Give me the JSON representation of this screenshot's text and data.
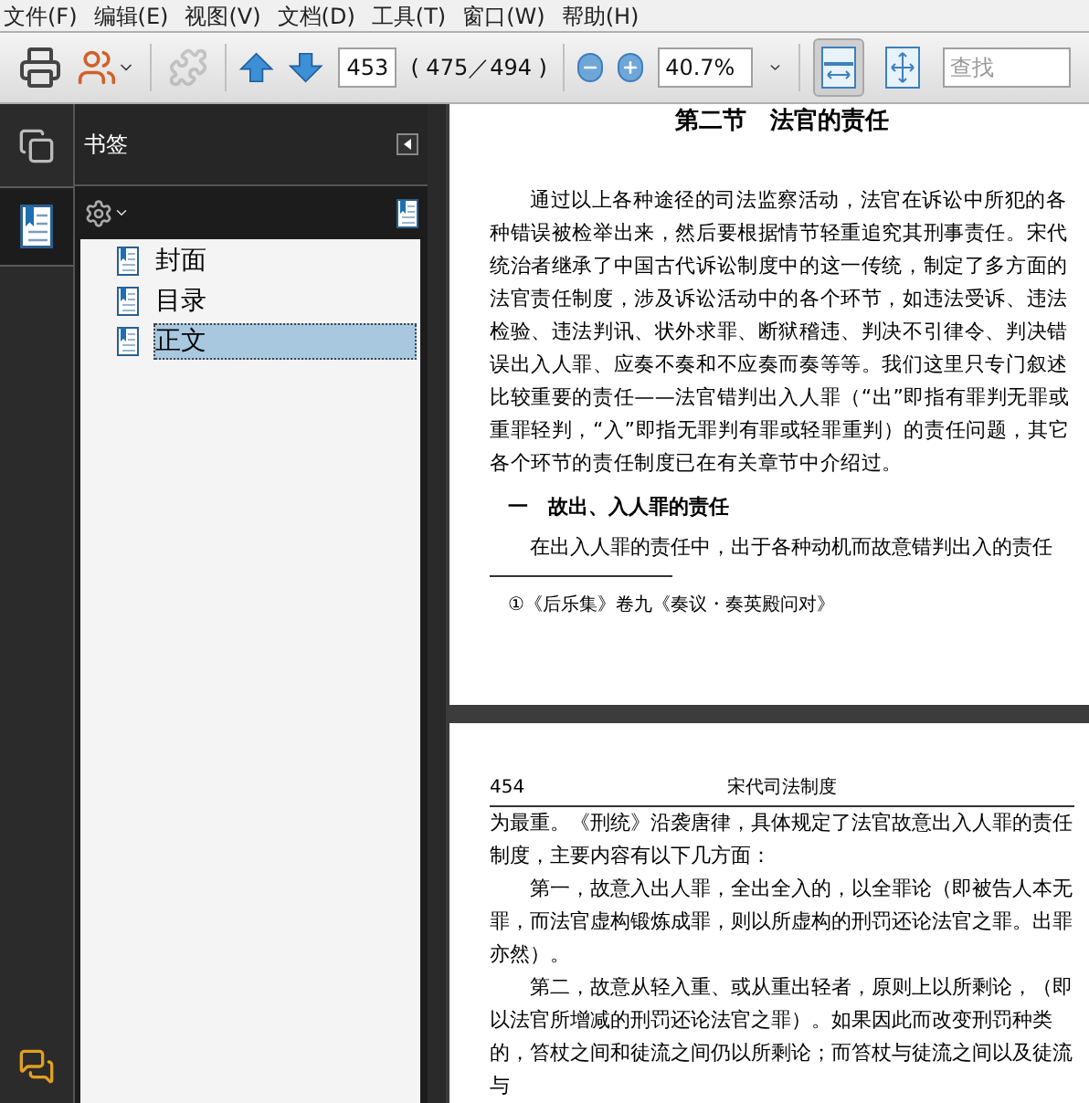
{
  "menu": [
    "文件(F)",
    "编辑(E)",
    "视图(V)",
    "文档(D)",
    "工具(T)",
    "窗口(W)",
    "帮助(H)"
  ],
  "toolbar": {
    "page_field": "453",
    "page_count": "( 475／494 )",
    "zoom_field": "40.7%",
    "search_placeholder": "查找",
    "fit_buttons": [
      {
        "kind": "fit-width",
        "selected": true
      },
      {
        "kind": "fit-page",
        "selected": false
      }
    ]
  },
  "sidebar": {
    "tabs": [
      {
        "kind": "pages",
        "selected": false
      },
      {
        "kind": "bookmarks",
        "selected": true
      }
    ],
    "panel_title": "书签",
    "bookmarks": [
      {
        "label": "封面",
        "selected": false
      },
      {
        "label": "目录",
        "selected": false
      },
      {
        "label": "正文",
        "selected": true
      }
    ]
  },
  "pages": [
    {
      "heading": "第二节　法官的责任",
      "paragraphs": [
        "通过以上各种途径的司法监察活动，法官在诉讼中所犯的各种错误被检举出来，然后要根据情节轻重追究其刑事责任。宋代统治者继承了中国古代诉讼制度中的这一传统，制定了多方面的法官责任制度，涉及诉讼活动中的各个环节，如违法受诉、违法检验、违法判讯、状外求罪、断狱稽违、判决不引律令、判决错误出入人罪、应奏不奏和不应奏而奏等等。我们这里只专门叙述比较重要的责任——法官错判出入人罪（“出”即指有罪判无罪或重罪轻判，“入”即指无罪判有罪或轻罪重判）的责任问题，其它各个环节的责任制度已在有关章节中介绍过。"
      ],
      "subheading": "一　故出、入人罪的责任",
      "closing": "在出入人罪的责任中，出于各种动机而故意错判出入的责任",
      "footnote": "①《后乐集》卷九《奏议・奏英殿问对》"
    },
    {
      "page_number": "454",
      "running_title": "宋代司法制度",
      "paragraphs": [
        "为最重。《刑统》沿袭唐律，具体规定了法官故意出入人罪的责任制度，主要内容有以下几方面：",
        "　　第一，故意入出人罪，全出全入的，以全罪论（即被告人本无罪，而法官虚构锻炼成罪，则以所虚构的刑罚还论法官之罪。出罪亦然）。",
        "　　第二，故意从轻入重、或从重出轻者，原则上以所剩论，（即以法官所增减的刑罚还论法官之罪）。如果因此而改变刑罚种类的，笞杖之间和徒流之间仍以所剩论；而笞杖与徒流之间以及徒流与"
      ]
    }
  ]
}
